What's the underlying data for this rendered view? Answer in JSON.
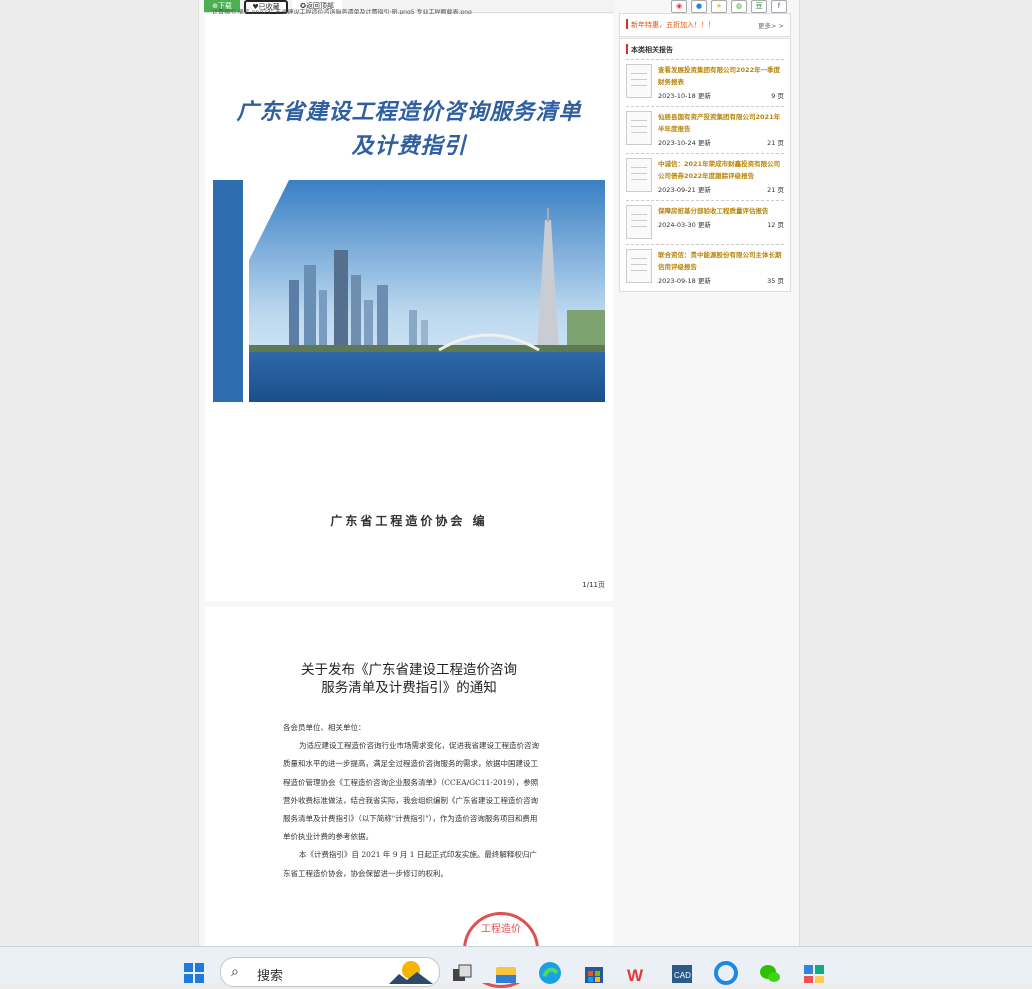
{
  "toolbar": {
    "download_label": "下载",
    "favorited_label": "已收藏",
    "back_top_label": "返回顶部",
    "file_path": "计费指引·册言.png23\" 东省建设工程造价咨询服务清单及计费指引·册.png5 专业工程额载表.png"
  },
  "document": {
    "page1": {
      "title_line1": "广东省建设工程造价咨询服务清单",
      "title_line2": "及计费指引",
      "publisher": "广东省工程造价协会 编",
      "page_indicator": "1/11页"
    },
    "page2": {
      "title_line1": "关于发布《广东省建设工程造价咨询",
      "title_line2": "服务清单及计费指引》的通知",
      "salutation": "各会员单位、相关单位：",
      "para1": "为适应建设工程造价咨询行业市场需求变化，促进我省建设工程造价咨询质量和水平的进一步提高，满足全过程造价咨询服务的需求，依据中国建设工程造价管理协会《工程造价咨询企业服务清单》（CCEA/GC11-2019），参照营外收费标准做法，结合我省实际，我会组织编制《广东省建设工程造价咨询服务清单及计费指引》（以下简称\"计费指引\"），作为造价咨询服务项目和费用单价执业计费的参考依据。",
      "para2": "本《计费指引》自 2021 年 9 月 1 日起正式印发实施。最终解释权归广东省工程造价协会，协会保留进一步修订的权利。",
      "seal_text": "工程造价"
    }
  },
  "sidebar": {
    "share_icons": [
      "weibo-icon",
      "qq-icon",
      "qzone-icon",
      "wechat-icon",
      "douban-icon",
      "facebook-icon"
    ],
    "notice_text": "新年特惠，五折加入！！！",
    "notice_more": "更多> >",
    "related_header": "本类相关报告",
    "related": [
      {
        "title": "查看发展投资集团有限公司2022年一季度财务报表",
        "date": "2023-10-18 更新",
        "pages": "9 页"
      },
      {
        "title": "仙居县国有资产投资集团有限公司2021年半年度报告",
        "date": "2023-10-24 更新",
        "pages": "21 页"
      },
      {
        "title": "中诚信：2021年荣成市财鑫投资有限公司公司债券2022年度跟踪评级报告",
        "date": "2023-09-21 更新",
        "pages": "21 页"
      },
      {
        "title": "保障房桩基分部验收工程质量评估报告",
        "date": "2024-03-30 更新",
        "pages": "12 页"
      },
      {
        "title": "联合资信：贵中能源股份有限公司主体长期信用评级报告",
        "date": "2023-09-18 更新",
        "pages": "35 页"
      }
    ]
  },
  "taskbar": {
    "search_label": "搜索",
    "apps": [
      "start-icon",
      "search-icon",
      "weather-icon",
      "task-view-icon",
      "file-explorer-icon",
      "edge-icon",
      "store-icon",
      "wps-icon",
      "cad-icon",
      "browser-icon",
      "wechat-app-icon",
      "widgets-icon"
    ]
  }
}
